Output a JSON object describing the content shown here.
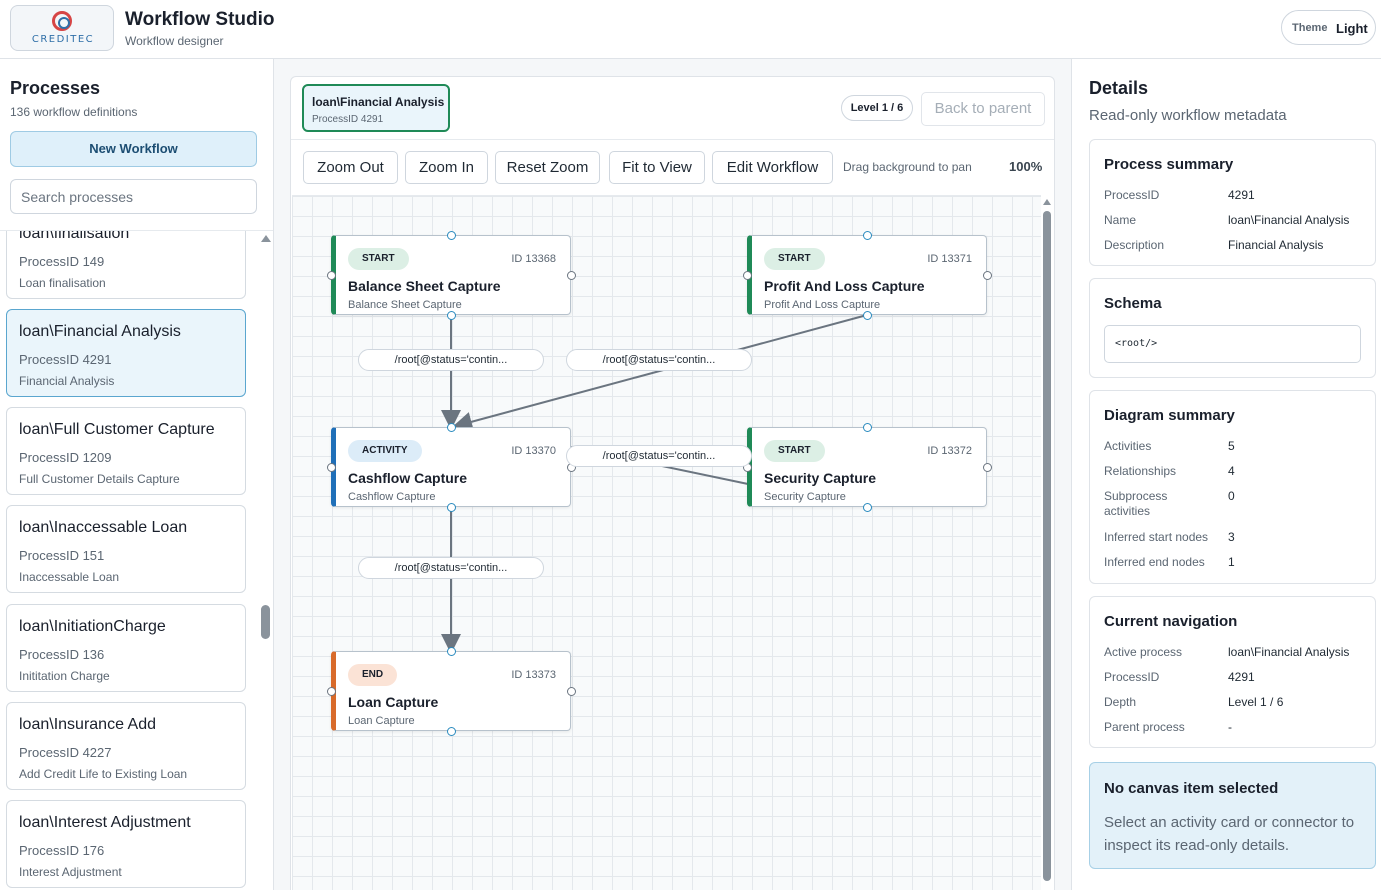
{
  "app": {
    "logo_text": "CREDITEC",
    "title": "Workflow Studio",
    "subtitle": "Workflow designer",
    "theme_label": "Theme",
    "theme_value": "Light"
  },
  "processes": {
    "title": "Processes",
    "count_text": "136 workflow definitions",
    "new_button": "New Workflow",
    "search_placeholder": "Search processes",
    "items": [
      {
        "name": "loan\\finalisation",
        "id": "ProcessID 149",
        "desc": "Loan finalisation"
      },
      {
        "name": "loan\\Financial Analysis",
        "id": "ProcessID 4291",
        "desc": "Financial Analysis",
        "active": true
      },
      {
        "name": "loan\\Full Customer Capture",
        "id": "ProcessID 1209",
        "desc": "Full Customer Details Capture"
      },
      {
        "name": "loan\\Inaccessable Loan",
        "id": "ProcessID 151",
        "desc": "Inaccessable Loan"
      },
      {
        "name": "loan\\InitiationCharge",
        "id": "ProcessID 136",
        "desc": "Inititation Charge"
      },
      {
        "name": "loan\\Insurance Add",
        "id": "ProcessID 4227",
        "desc": "Add Credit Life to Existing Loan"
      },
      {
        "name": "loan\\Interest Adjustment",
        "id": "ProcessID 176",
        "desc": "Interest Adjustment"
      }
    ]
  },
  "canvas": {
    "breadcrumb": {
      "name": "loan\\Financial Analysis",
      "id": "ProcessID 4291"
    },
    "level": "Level 1 / 6",
    "back_button": "Back to parent",
    "toolbar": {
      "zoom_out": "Zoom Out",
      "zoom_in": "Zoom In",
      "reset_zoom": "Reset Zoom",
      "fit_to_view": "Fit to View",
      "edit_workflow": "Edit Workflow",
      "drag_hint": "Drag background to pan",
      "zoom_level": "100%"
    },
    "nodes": [
      {
        "type": "START",
        "id": "ID 13368",
        "title": "Balance Sheet Capture",
        "sub": "Balance Sheet Capture"
      },
      {
        "type": "START",
        "id": "ID 13371",
        "title": "Profit And Loss Capture",
        "sub": "Profit And Loss Capture"
      },
      {
        "type": "ACTIVITY",
        "id": "ID 13370",
        "title": "Cashflow Capture",
        "sub": "Cashflow Capture"
      },
      {
        "type": "START",
        "id": "ID 13372",
        "title": "Security Capture",
        "sub": "Security Capture"
      },
      {
        "type": "END",
        "id": "ID 13373",
        "title": "Loan Capture",
        "sub": "Loan Capture"
      }
    ],
    "edge_labels": [
      "/root[@status='contin...",
      "/root[@status='contin...",
      "/root[@status='contin...",
      "/root[@status='contin..."
    ]
  },
  "details": {
    "title": "Details",
    "subtitle": "Read-only workflow metadata",
    "process_summary": {
      "title": "Process summary",
      "rows": [
        {
          "key": "ProcessID",
          "value": "4291"
        },
        {
          "key": "Name",
          "value": "loan\\Financial Analysis"
        },
        {
          "key": "Description",
          "value": "Financial Analysis"
        }
      ]
    },
    "schema": {
      "title": "Schema",
      "value": "<root/>"
    },
    "diagram_summary": {
      "title": "Diagram summary",
      "rows": [
        {
          "key": "Activities",
          "value": "5"
        },
        {
          "key": "Relationships",
          "value": "4"
        },
        {
          "key": "Subprocess activities",
          "value": "0"
        },
        {
          "key": "Inferred start nodes",
          "value": "3"
        },
        {
          "key": "Inferred end nodes",
          "value": "1"
        }
      ]
    },
    "navigation": {
      "title": "Current navigation",
      "rows": [
        {
          "key": "Active process",
          "value": "loan\\Financial Analysis"
        },
        {
          "key": "ProcessID",
          "value": "4291"
        },
        {
          "key": "Depth",
          "value": "Level 1 / 6"
        },
        {
          "key": "Parent process",
          "value": "-"
        }
      ]
    },
    "selection": {
      "title": "No canvas item selected",
      "body": "Select an activity card or connector to inspect its read-only details."
    }
  }
}
